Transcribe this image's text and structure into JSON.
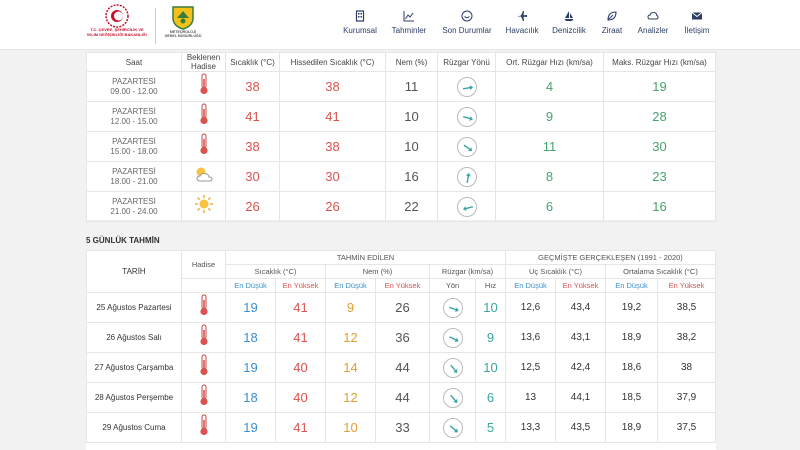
{
  "logos": {
    "ministry_text": [
      "T.C. ÇEVRE, ŞEHİRCİLİK VE",
      "İKLİM DEĞİŞİKLİĞİ BAKANLIĞI"
    ],
    "mgm_text": [
      "METEOROLOJİ",
      "GENEL MÜDÜRLÜĞÜ"
    ]
  },
  "nav": [
    {
      "label": "Kurumsal",
      "icon": "building-icon"
    },
    {
      "label": "Tahminler",
      "icon": "chart-icon"
    },
    {
      "label": "Son Durumlar",
      "icon": "gauge-icon"
    },
    {
      "label": "Havacılık",
      "icon": "plane-icon"
    },
    {
      "label": "Denizcilik",
      "icon": "sailboat-icon"
    },
    {
      "label": "Ziraat",
      "icon": "leaf-icon"
    },
    {
      "label": "Analizler",
      "icon": "cloud-analysis-icon"
    },
    {
      "label": "İletişim",
      "icon": "mail-icon"
    }
  ],
  "hourly": {
    "headers": [
      "Saat",
      "Beklenen Hadise",
      "Sıcaklık (°C)",
      "Hissedilen Sıcaklık (°C)",
      "Nem (%)",
      "Rüzgar Yönü",
      "Ort. Rüzgar Hızı (km/sa)",
      "Maks. Rüzgar Hızı (km/sa)"
    ],
    "rows": [
      {
        "day": "PAZARTESİ",
        "time": "09.00 - 12.00",
        "event": "thermometer-icon",
        "temp": "38",
        "feels": "38",
        "humidity": "11",
        "wind_deg": 80,
        "avg": "4",
        "max": "19"
      },
      {
        "day": "PAZARTESİ",
        "time": "12.00 - 15.00",
        "event": "thermometer-icon",
        "temp": "41",
        "feels": "41",
        "humidity": "10",
        "wind_deg": 105,
        "avg": "9",
        "max": "28"
      },
      {
        "day": "PAZARTESİ",
        "time": "15.00 - 18.00",
        "event": "thermometer-icon",
        "temp": "38",
        "feels": "38",
        "humidity": "10",
        "wind_deg": 125,
        "avg": "11",
        "max": "30"
      },
      {
        "day": "PAZARTESİ",
        "time": "18.00 - 21.00",
        "event": "partly-cloudy-icon",
        "temp": "30",
        "feels": "30",
        "humidity": "16",
        "wind_deg": 10,
        "avg": "8",
        "max": "23"
      },
      {
        "day": "PAZARTESİ",
        "time": "21.00 - 24.00",
        "event": "sun-icon",
        "temp": "26",
        "feels": "26",
        "humidity": "22",
        "wind_deg": 255,
        "avg": "6",
        "max": "16"
      }
    ]
  },
  "five_day": {
    "title": "5 GÜNLÜK TAHMİN",
    "group_forecast": "TAHMİN EDİLEN",
    "group_past": "GEÇMİŞTE GERÇEKLEŞEN (1991 - 2020)",
    "col_date": "TARİH",
    "col_event": "Hadise",
    "col_temp": "Sıcaklık (°C)",
    "col_hum": "Nem (%)",
    "col_wind": "Rüzgar (km/sa)",
    "col_extreme": "Uç Sıcaklık (°C)",
    "col_avg": "Ortalama Sıcaklık (°C)",
    "sub_low": "En Düşük",
    "sub_high": "En Yüksek",
    "sub_dir": "Yön",
    "sub_speed": "Hız",
    "rows": [
      {
        "date": "25 Ağustos Pazartesi",
        "tlo": "19",
        "thi": "41",
        "hlo": "9",
        "hhi": "26",
        "wind_deg": 110,
        "speed": "10",
        "xlo": "12,6",
        "xhi": "43,4",
        "alo": "19,2",
        "ahi": "38,5"
      },
      {
        "date": "26 Ağustos Salı",
        "tlo": "18",
        "thi": "41",
        "hlo": "12",
        "hhi": "36",
        "wind_deg": 115,
        "speed": "9",
        "xlo": "13,6",
        "xhi": "43,1",
        "alo": "18,9",
        "ahi": "38,2"
      },
      {
        "date": "27 Ağustos Çarşamba",
        "tlo": "19",
        "thi": "40",
        "hlo": "14",
        "hhi": "44",
        "wind_deg": 140,
        "speed": "10",
        "xlo": "12,5",
        "xhi": "42,4",
        "alo": "18,6",
        "ahi": "38"
      },
      {
        "date": "28 Ağustos Perşembe",
        "tlo": "18",
        "thi": "40",
        "hlo": "12",
        "hhi": "44",
        "wind_deg": 140,
        "speed": "6",
        "xlo": "13",
        "xhi": "44,1",
        "alo": "18,5",
        "ahi": "37,9"
      },
      {
        "date": "29 Ağustos Cuma",
        "tlo": "19",
        "thi": "41",
        "hlo": "10",
        "hhi": "33",
        "wind_deg": 130,
        "speed": "5",
        "xlo": "13,3",
        "xhi": "43,5",
        "alo": "18,9",
        "ahi": "37,5"
      }
    ]
  },
  "colors": {
    "temp": "#d9534f",
    "feels": "#d9534f",
    "humidity": "#555555",
    "avg_wind": "#48a36d",
    "max_wind": "#48a36d",
    "nav": "#2c3e66"
  }
}
